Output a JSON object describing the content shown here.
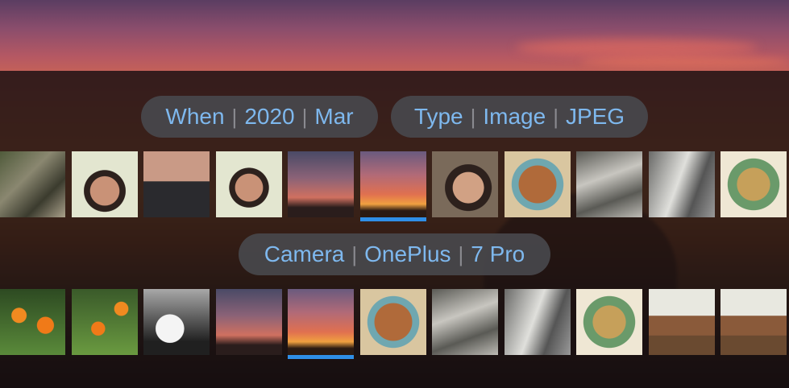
{
  "filters": {
    "when": {
      "label": "When",
      "year": "2020",
      "month": "Mar"
    },
    "type": {
      "label": "Type",
      "kind": "Image",
      "format": "JPEG"
    },
    "camera": {
      "label": "Camera",
      "make": "OnePlus",
      "model": "7 Pro"
    },
    "separator": "|"
  },
  "colors": {
    "accent": "#2f8fe6",
    "pill_text": "#7eb8ee"
  },
  "row1_thumbs": [
    {
      "name": "thumb-bike-trail",
      "bg": "linear-gradient(135deg,#4f5a3a,#8a8770 40%,#3b3b2e 70%,#a9a08a)"
    },
    {
      "name": "thumb-selfie-1",
      "bg": "radial-gradient(circle at 50% 60%, #c99277 0 28%, #2d211d 29% 40%, #e3e6d0 41%)"
    },
    {
      "name": "thumb-selfie-2",
      "bg": "linear-gradient(180deg,#c99a86 0 45%, #2a2a2e 46%)"
    },
    {
      "name": "thumb-selfie-3",
      "bg": "radial-gradient(circle at 50% 55%, #c99277 0 28%, #2d211d 29% 40%, #e3e6d0 41%)"
    },
    {
      "name": "thumb-sunset-1",
      "bg": "linear-gradient(180deg,#4a4a66,#8a6277 40%,#d07060 70%,#2a1d1c 85%)"
    },
    {
      "name": "thumb-sunset-2",
      "bg": "linear-gradient(180deg,#6a5a7e,#b06a78 35%,#e07050 65%,#f0a040 80%,#2a1a12 90%)",
      "selected": true
    },
    {
      "name": "thumb-glasses-portrait",
      "bg": "radial-gradient(circle at 55% 55%, #d1a184 0 30%, #2d211d 31% 45%, #7a6a5a 46%)"
    },
    {
      "name": "thumb-puzzle-1",
      "bg": "radial-gradient(circle at 50% 50%, #b06a3a 0 40%, #6fa7b0 41% 55%, #d9c6a0 56%)"
    },
    {
      "name": "thumb-deck-kids-1",
      "bg": "linear-gradient(160deg,#5a5a55,#c8c6c0 40%,#5a5a55 70%,#bdbbb5)"
    },
    {
      "name": "thumb-floor-boards-1",
      "bg": "linear-gradient(110deg,#6a6a68,#e0e0dc 45%,#555 70%,#999)"
    },
    {
      "name": "thumb-map-puzzle-1",
      "bg": "radial-gradient(circle at 50% 50%, #c6a05a 0 35%, #6a9a6a 36% 55%, #efe7d4 56%)"
    }
  ],
  "row2_thumbs": [
    {
      "name": "thumb-poppies-1",
      "bg": "radial-gradient(circle at 30% 40%, #f08a20 0 12%, transparent 13%), radial-gradient(circle at 70% 55%, #f07a18 0 14%, transparent 15%), linear-gradient(180deg,#2d4a22,#5a8a3a)"
    },
    {
      "name": "thumb-poppies-2",
      "bg": "radial-gradient(circle at 40% 60%, #f07a18 0 12%, transparent 13%), radial-gradient(circle at 75% 30%, #f08a20 0 10%, transparent 11%), linear-gradient(180deg,#3a5a2a,#6a9a40)"
    },
    {
      "name": "thumb-cat-blanket",
      "bg": "radial-gradient(circle at 40% 60%, #f4f4f4 0 25%, transparent 26%), linear-gradient(180deg,#a8a8a8,#202020 80%)"
    },
    {
      "name": "thumb-sunset-3",
      "bg": "linear-gradient(180deg,#4a4a66,#8a6277 40%,#d07060 70%,#2a1d1c 85%)"
    },
    {
      "name": "thumb-sunset-4",
      "bg": "linear-gradient(180deg,#6a5a7e,#b06a78 35%,#e07050 65%,#f0a040 80%,#2a1a12 90%)",
      "selected": true
    },
    {
      "name": "thumb-puzzle-2",
      "bg": "radial-gradient(circle at 50% 50%, #b06a3a 0 40%, #6fa7b0 41% 55%, #d9c6a0 56%)"
    },
    {
      "name": "thumb-deck-kids-2",
      "bg": "linear-gradient(160deg,#5a5a55,#c8c6c0 40%,#5a5a55 70%,#bdbbb5)"
    },
    {
      "name": "thumb-floor-boards-2",
      "bg": "linear-gradient(110deg,#6a6a68,#e0e0dc 45%,#555 70%,#999)"
    },
    {
      "name": "thumb-map-puzzle-2",
      "bg": "radial-gradient(circle at 50% 50%, #c6a05a 0 35%, #6a9a6a 36% 55%, #efe7d4 56%)"
    },
    {
      "name": "thumb-dining-room-1",
      "bg": "linear-gradient(180deg,#e8e8e0 0 40%, #8a5a3a 41% 70%, #6a4a30 71%)"
    },
    {
      "name": "thumb-dining-room-2",
      "bg": "linear-gradient(180deg,#e8e8e0 0 40%, #8a5a3a 41% 70%, #6a4a30 71%)"
    }
  ]
}
